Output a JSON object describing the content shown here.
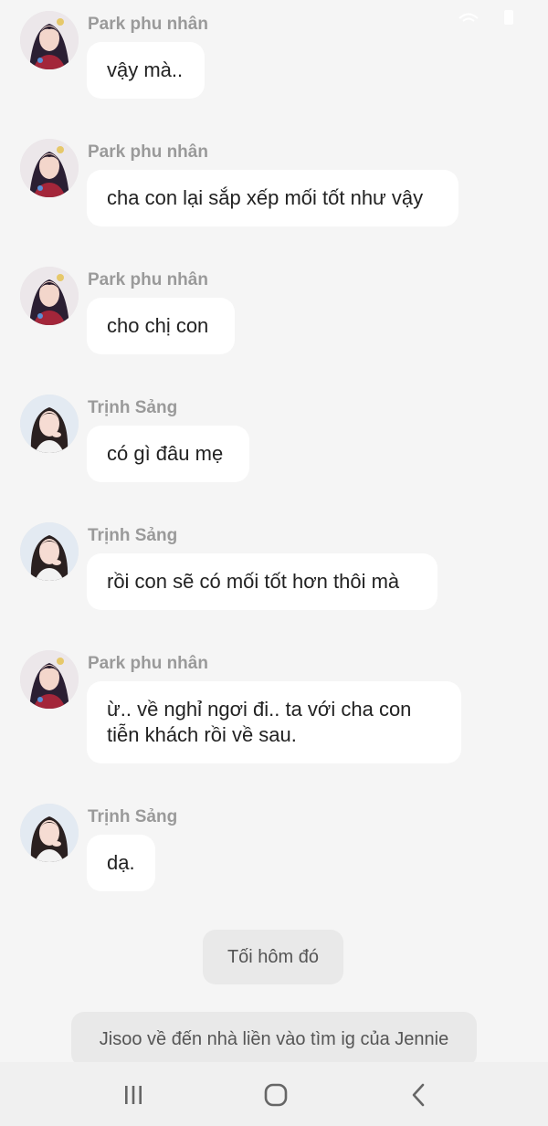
{
  "colors": {
    "background": "#f5f5f5",
    "bubble": "#ffffff",
    "sender_name": "#9a9a9a",
    "message_text": "#222222",
    "note_bg": "#e9e9e9",
    "navbar_bg": "#f0f0f0"
  },
  "messages": [
    {
      "sender": "Park phu nhân",
      "avatar": "park-avatar-icon",
      "text": "vậy mà.."
    },
    {
      "sender": "Park phu nhân",
      "avatar": "park-avatar-icon",
      "text": "cha con lại sắp xếp mối tốt như vậy"
    },
    {
      "sender": "Park phu nhân",
      "avatar": "park-avatar-icon",
      "text": "cho chị con"
    },
    {
      "sender": "Trịnh Sảng",
      "avatar": "trinh-avatar-icon",
      "text": "có gì đâu mẹ"
    },
    {
      "sender": "Trịnh Sảng",
      "avatar": "trinh-avatar-icon",
      "text": "rồi con sẽ có mối tốt hơn thôi mà"
    },
    {
      "sender": "Park phu nhân",
      "avatar": "park-avatar-icon",
      "text": "ừ.. về nghỉ ngơi đi.. ta với cha con\ntiễn khách rồi về sau."
    },
    {
      "sender": "Trịnh Sảng",
      "avatar": "trinh-avatar-icon",
      "text": "dạ."
    }
  ],
  "narration": [
    "Tối hôm đó",
    "Jisoo về đến nhà liền vào tìm ig của Jennie"
  ],
  "navbar": {
    "recent_icon": "recent-apps-icon",
    "home_icon": "home-icon",
    "back_icon": "back-icon"
  }
}
